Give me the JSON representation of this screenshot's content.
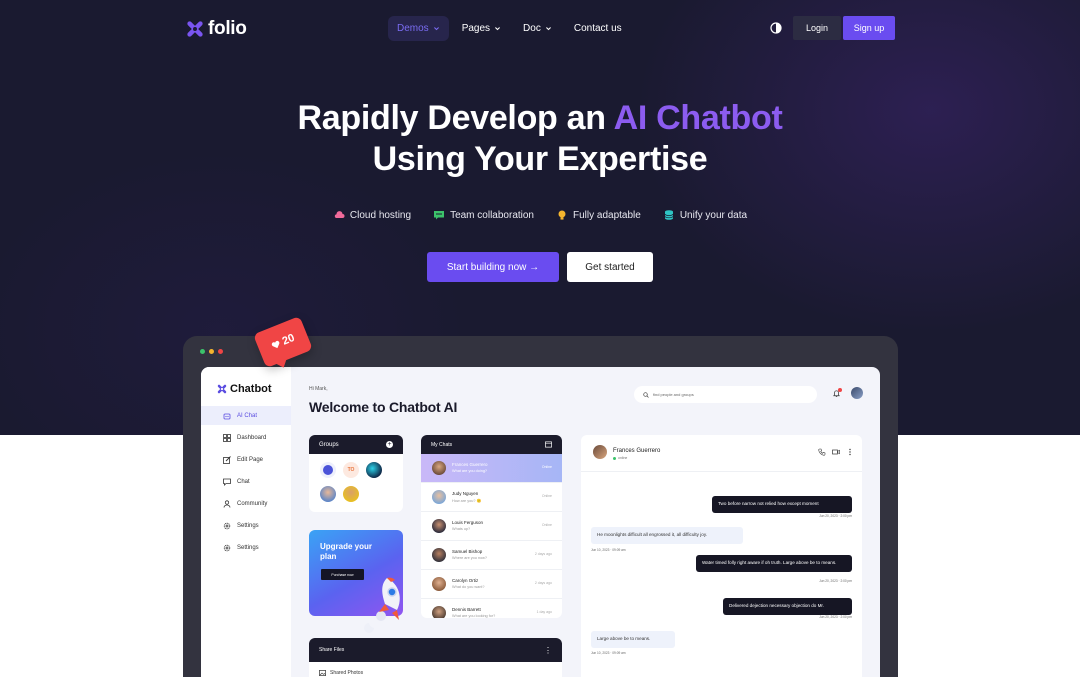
{
  "brand": {
    "name": "folio"
  },
  "nav": {
    "items": [
      {
        "label": "Demos",
        "has_caret": true,
        "active": true
      },
      {
        "label": "Pages",
        "has_caret": true,
        "active": false
      },
      {
        "label": "Doc",
        "has_caret": true,
        "active": false
      },
      {
        "label": "Contact us",
        "has_caret": false,
        "active": false
      }
    ],
    "theme_icon": "contrast-icon",
    "login_label": "Login",
    "signup_label": "Sign up"
  },
  "hero": {
    "headline_part1": "Rapidly Develop an ",
    "headline_accent": "AI Chatbot",
    "headline_line2": "Using Your Expertise",
    "features": [
      {
        "icon": "cloud-icon",
        "label": "Cloud hosting"
      },
      {
        "icon": "chat-bubble-icon",
        "label": "Team collaboration"
      },
      {
        "icon": "lightbulb-icon",
        "label": "Fully adaptable"
      },
      {
        "icon": "database-icon",
        "label": "Unify your data"
      }
    ],
    "primary_cta": "Start building now →",
    "secondary_cta": "Get started"
  },
  "like_badge": {
    "count": "20"
  },
  "app": {
    "brand": "Chatbot",
    "sidebar": [
      {
        "label": "AI Chat",
        "icon": "robot-icon",
        "active": true
      },
      {
        "label": "Dashboard",
        "icon": "grid-icon",
        "active": false
      },
      {
        "label": "Edit Page",
        "icon": "edit-icon",
        "active": false
      },
      {
        "label": "Chat",
        "icon": "chat-icon",
        "active": false
      },
      {
        "label": "Community",
        "icon": "people-icon",
        "active": false
      },
      {
        "label": "Settings",
        "icon": "gear-icon",
        "active": false
      },
      {
        "label": "Settings",
        "icon": "gear-icon",
        "active": false
      }
    ],
    "greeting": "Hi Mark,",
    "welcome": "Welcome to Chatbot AI",
    "search_placeholder": "find people and groups",
    "groups": {
      "title": "Groups",
      "initials": "TO"
    },
    "upgrade": {
      "title": "Upgrade your plan",
      "button": "Purchase now"
    },
    "my_chats": {
      "title": "My Chats",
      "rows": [
        {
          "name": "Frances Guerrero",
          "message": "What are you doing?",
          "time": "Online",
          "active": true
        },
        {
          "name": "Judy Nguyen",
          "message": "How are you? 🙂",
          "time": "Online",
          "active": false
        },
        {
          "name": "Louis Ferguson",
          "message": "Whats up?",
          "time": "Online",
          "active": false
        },
        {
          "name": "Samuel Bishop",
          "message": "Where are you now?",
          "time": "2 days ago",
          "active": false
        },
        {
          "name": "Carolyn Ortiz",
          "message": "What do you want?",
          "time": "2 days ago",
          "active": false
        },
        {
          "name": "Dennis Barrett",
          "message": "What are you looking for?",
          "time": "1 day ago",
          "active": false
        }
      ]
    },
    "share_files": {
      "title": "Share Files",
      "item": "Shared Photos"
    },
    "conversation": {
      "contact_name": "Frances Guerrero",
      "status": "online",
      "messages": [
        {
          "side": "out",
          "text": "Two before narrow not relied how except moment",
          "time": "Jun 20, 2023 · 2:00 pm"
        },
        {
          "side": "in",
          "text": "He moonlights difficult all engrossed it, all difficulty joy.",
          "time": "Jun 10, 2023 · 09:09 am"
        },
        {
          "side": "out",
          "text": "Water timed folly right aware if oh truth. Large above be to means.",
          "time": "Jun 20, 2023 · 2:00 pm"
        },
        {
          "side": "out",
          "text": "Delivered dejection necessary objection do Mr.",
          "time": "Jun 20, 2023 · 2:00 pm"
        },
        {
          "side": "in",
          "text": "Large above be to means.",
          "time": "Jun 10, 2023 · 09:09 am"
        }
      ]
    }
  },
  "colors": {
    "hero_bg": "#1a1a30",
    "accent": "#6a4cf0",
    "headline_accent": "#8c5cf0",
    "badge": "#f04545"
  }
}
